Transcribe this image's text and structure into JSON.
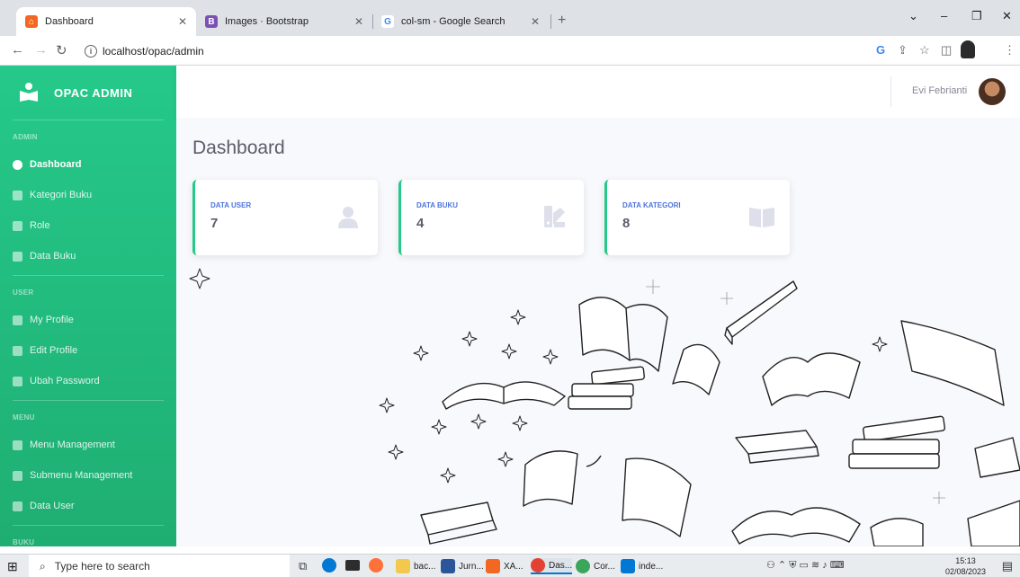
{
  "browser": {
    "tabs": [
      {
        "title": "Dashboard",
        "favicon_color": "#f26722",
        "favicon_glyph": "⌂",
        "active": true
      },
      {
        "title": "Images · Bootstrap",
        "favicon_color": "#7952b3",
        "favicon_glyph": "B",
        "active": false
      },
      {
        "title": "col-sm - Google Search",
        "favicon_color": "#4285f4",
        "favicon_glyph": "G",
        "active": false
      }
    ],
    "url": "localhost/opac/admin"
  },
  "sidebar": {
    "brand": "OPAC ADMIN",
    "sections": [
      {
        "heading": "ADMIN",
        "items": [
          {
            "label": "Dashboard",
            "active": true,
            "icon": "tachometer-icon"
          },
          {
            "label": "Kategori Buku",
            "active": false,
            "icon": "book-icon"
          },
          {
            "label": "Role",
            "active": false,
            "icon": "user-icon"
          },
          {
            "label": "Data Buku",
            "active": false,
            "icon": "book-open-icon"
          }
        ]
      },
      {
        "heading": "USER",
        "items": [
          {
            "label": "My Profile",
            "active": false,
            "icon": "user-icon"
          },
          {
            "label": "Edit Profile",
            "active": false,
            "icon": "user-edit-icon"
          },
          {
            "label": "Ubah Password",
            "active": false,
            "icon": "user-lock-icon"
          }
        ]
      },
      {
        "heading": "MENU",
        "items": [
          {
            "label": "Menu Management",
            "active": false,
            "icon": "folder-icon"
          },
          {
            "label": "Submenu Management",
            "active": false,
            "icon": "folder-open-icon"
          },
          {
            "label": "Data User",
            "active": false,
            "icon": "users-icon"
          }
        ]
      },
      {
        "heading": "BUKU",
        "items": []
      }
    ]
  },
  "topbar": {
    "user_name": "Evi Febrianti"
  },
  "main": {
    "title": "Dashboard",
    "cards": [
      {
        "label": "DATA USER",
        "value": "7",
        "icon": "user-icon"
      },
      {
        "label": "DATA BUKU",
        "value": "4",
        "icon": "book-swatch-icon"
      },
      {
        "label": "DATA KATEGORI",
        "value": "8",
        "icon": "book-open-icon"
      }
    ]
  },
  "taskbar": {
    "search_placeholder": "Type here to search",
    "apps": [
      {
        "label": "bac...",
        "color": "#f2c94c"
      },
      {
        "label": "Jurn...",
        "color": "#2b579a"
      },
      {
        "label": "XA...",
        "color": "#f26722"
      },
      {
        "label": "Das...",
        "color": "#e34133"
      },
      {
        "label": "Cor...",
        "color": "#3ba55c"
      },
      {
        "label": "inde...",
        "color": "#0078d4"
      }
    ],
    "time": "15:13",
    "date": "02/08/2023"
  },
  "colors": {
    "sidebar": "#25c98a",
    "accent_label": "#4e73df"
  }
}
